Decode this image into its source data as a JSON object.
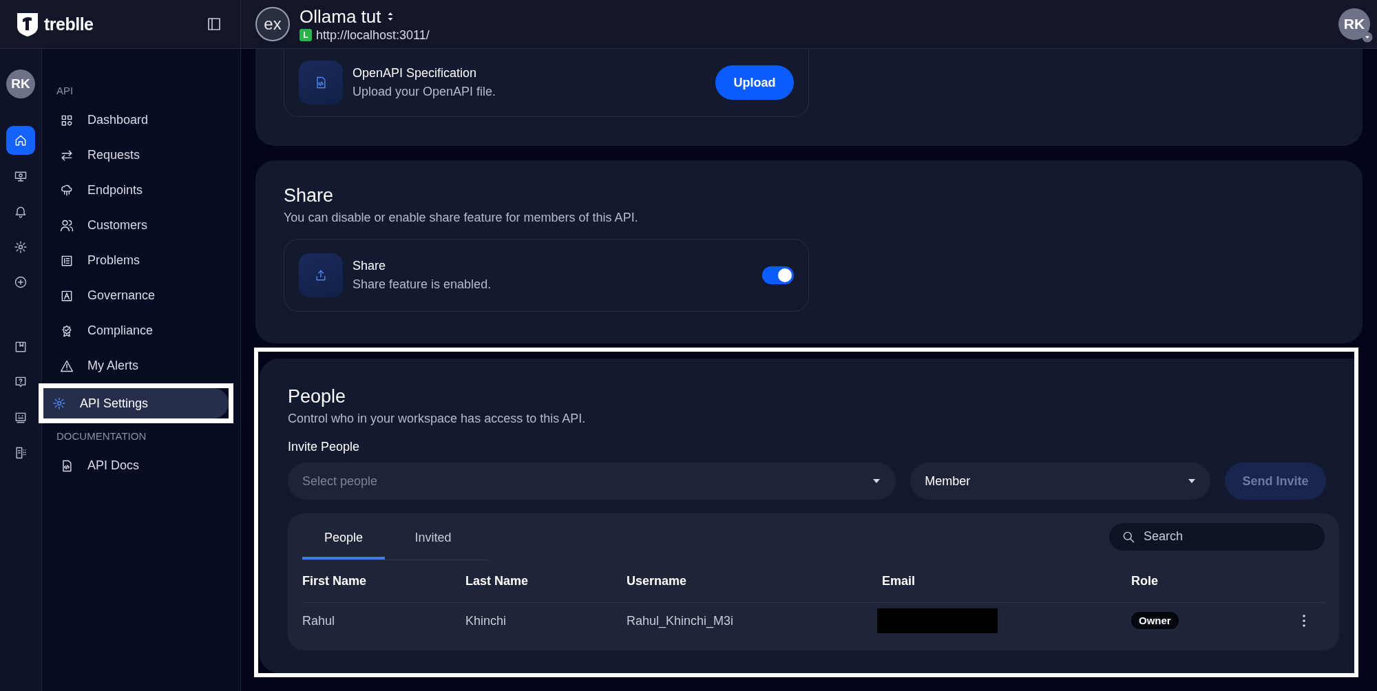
{
  "header": {
    "logo_text": "treblle",
    "project": {
      "badge": "ex",
      "title": "Ollama tut",
      "env": "L",
      "url": "http://localhost:3011/"
    },
    "user_initials": "RK"
  },
  "rail": {
    "avatar": "RK",
    "groups": [
      [
        {
          "kind": "home",
          "selected": true
        },
        {
          "kind": "monitor",
          "selected": false
        },
        {
          "kind": "bell",
          "selected": false
        },
        {
          "kind": "gear",
          "selected": false
        },
        {
          "kind": "plus",
          "selected": false
        }
      ],
      [
        {
          "kind": "bookmark",
          "selected": false
        },
        {
          "kind": "help",
          "selected": false
        },
        {
          "kind": "chat",
          "selected": false
        },
        {
          "kind": "docgrid",
          "selected": false
        }
      ]
    ]
  },
  "sidebar": {
    "sections": [
      {
        "heading": "API",
        "items": [
          {
            "label": "Dashboard",
            "kind": "dashboard",
            "selected": false,
            "highlighted": false
          },
          {
            "label": "Requests",
            "kind": "arrows",
            "selected": false,
            "highlighted": false
          },
          {
            "label": "Endpoints",
            "kind": "cloud",
            "selected": false,
            "highlighted": false
          },
          {
            "label": "Customers",
            "kind": "users",
            "selected": false,
            "highlighted": false
          },
          {
            "label": "Problems",
            "kind": "list",
            "selected": false,
            "highlighted": false
          },
          {
            "label": "Governance",
            "kind": "governance",
            "selected": false,
            "highlighted": false
          },
          {
            "label": "Compliance",
            "kind": "badge",
            "selected": false,
            "highlighted": false
          },
          {
            "label": "My Alerts",
            "kind": "alert",
            "selected": false,
            "highlighted": false
          },
          {
            "label": "API Settings",
            "kind": "gear",
            "selected": true,
            "highlighted": true
          }
        ]
      },
      {
        "heading": "DOCUMENTATION",
        "items": [
          {
            "label": "API Docs",
            "kind": "filecode",
            "selected": false,
            "highlighted": false
          }
        ]
      }
    ]
  },
  "openapi": {
    "title": "OpenAPI Specification",
    "description": "Upload your OpenAPI file.",
    "button": "Upload"
  },
  "share": {
    "title": "Share",
    "description": "You can disable or enable share feature for members of this API.",
    "setting": {
      "title": "Share",
      "description": "Share feature is enabled.",
      "on": true
    }
  },
  "people": {
    "highlighted": true,
    "title": "People",
    "description": "Control who in your workspace has access to this API.",
    "invite_label": "Invite People",
    "select": {
      "placeholder": "Select people"
    },
    "role": {
      "value": "Member"
    },
    "send_button": {
      "label": "Send Invite",
      "disabled": true
    },
    "tabs": [
      {
        "label": "People",
        "selected": true
      },
      {
        "label": "Invited",
        "selected": false
      }
    ],
    "search": {
      "placeholder": "Search"
    },
    "table": {
      "columns": [
        "First Name",
        "Last Name",
        "Username",
        "Email",
        "Role"
      ],
      "rows": [
        {
          "cells": [
            {
              "kind": "text",
              "text": "Rahul"
            },
            {
              "kind": "text",
              "text": "Khinchi"
            },
            {
              "kind": "text",
              "text": "Rahul_Khinchi_M3i"
            },
            {
              "kind": "redacted"
            },
            {
              "kind": "badge",
              "text": "Owner"
            }
          ]
        }
      ]
    }
  }
}
